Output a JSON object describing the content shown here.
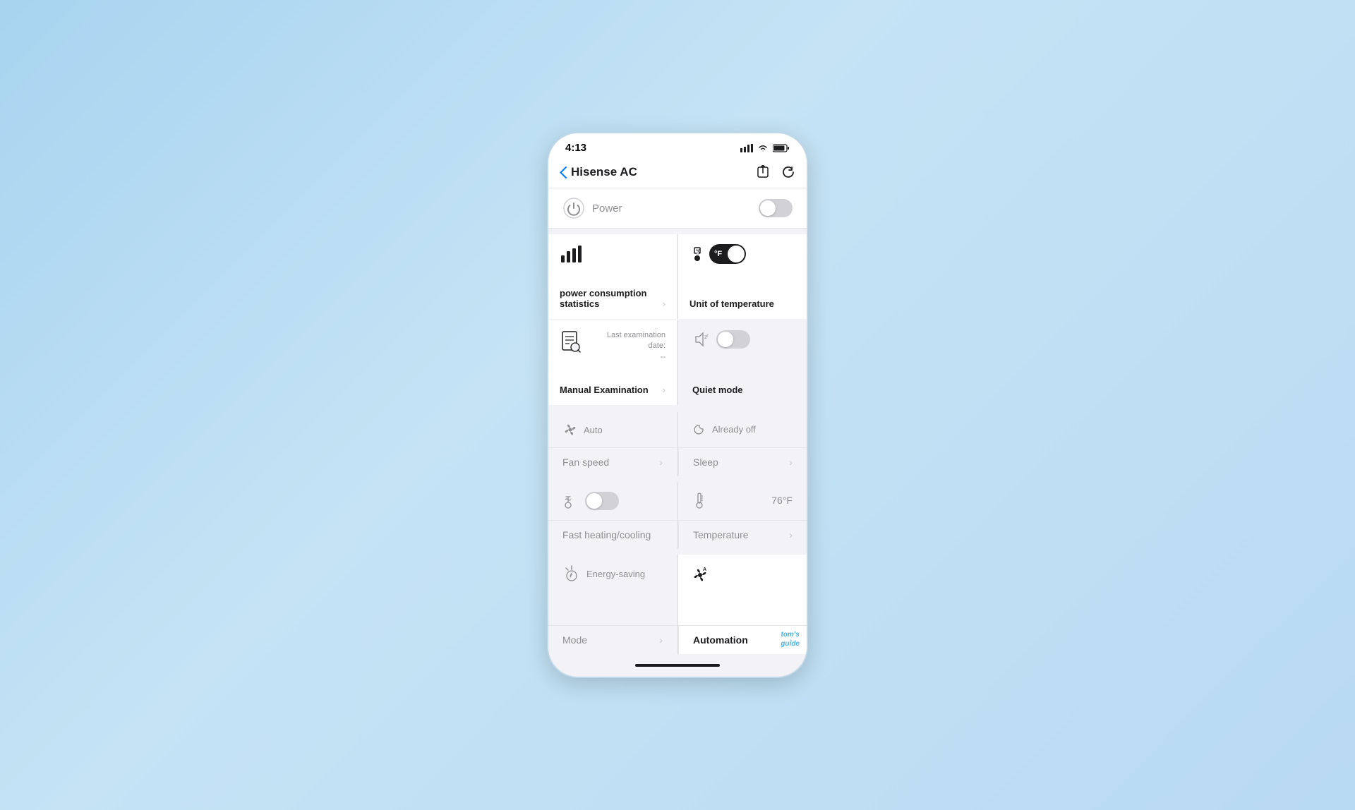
{
  "status_bar": {
    "time": "4:13"
  },
  "header": {
    "back_label": "‹",
    "title": "Hisense AC"
  },
  "power_row": {
    "icon": "⏻",
    "label": "Power"
  },
  "power_consumption_card": {
    "label": "power consumption statistics",
    "icon": "📊"
  },
  "unit_of_temperature_card": {
    "label": "Unit of temperature",
    "toggle_label": "°F"
  },
  "manual_examination_card": {
    "label": "Manual Examination",
    "last_exam_prefix": "Last examination",
    "last_exam_date": "date:",
    "last_exam_value": "--"
  },
  "quiet_mode": {
    "label": "Quiet mode"
  },
  "fan_speed": {
    "icon_label": "Auto",
    "label": "Fan speed"
  },
  "sleep": {
    "icon_label": "Already off",
    "label": "Sleep"
  },
  "fast_heating": {
    "label": "Fast heating/cooling"
  },
  "temperature": {
    "label": "Temperature",
    "value": "76°F"
  },
  "mode": {
    "icon_label": "Energy-saving",
    "label": "Mode"
  },
  "automation": {
    "label": "Automation"
  },
  "watermark": {
    "line1": "tom's",
    "line2": "guide"
  }
}
